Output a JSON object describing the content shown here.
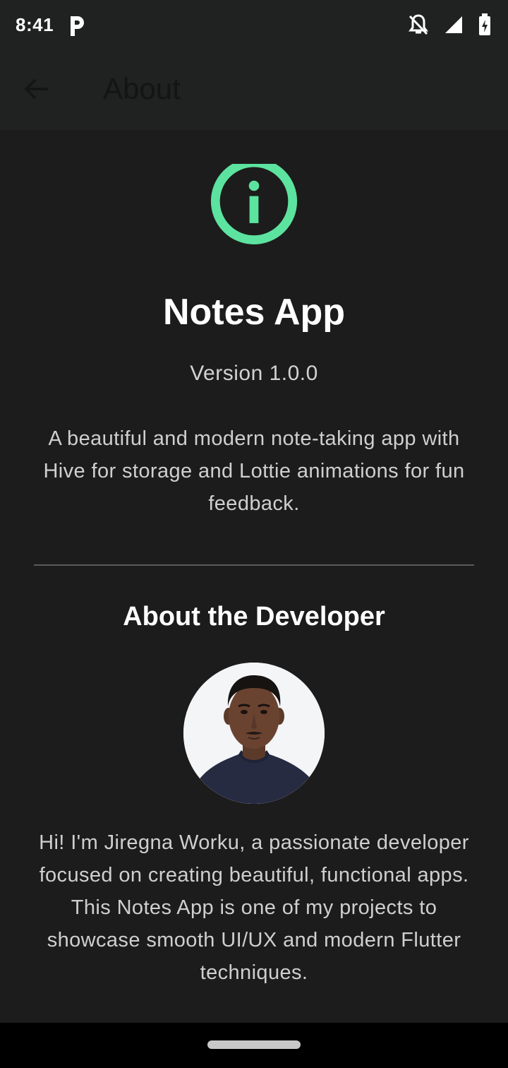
{
  "status_bar": {
    "time": "8:41",
    "icons": [
      "p-app-icon",
      "notifications-off-icon",
      "signal-icon",
      "battery-icon"
    ]
  },
  "app_bar": {
    "title": "About",
    "back_icon": "arrow-back-icon"
  },
  "about": {
    "icon": "info-icon",
    "app_name": "Notes App",
    "version": "Version 1.0.0",
    "description": "A beautiful and modern note-taking app with Hive for storage and Lottie animations for fun feedback.",
    "developer_heading": "About the Developer",
    "developer_bio": "Hi! I'm Jiregna Worku, a passionate developer focused on creating beautiful, functional apps. This Notes App is one of my projects to showcase smooth UI/UX and modern Flutter techniques."
  },
  "colors": {
    "background": "#1c1c1c",
    "app_bar": "#1f2221",
    "accent": "#5ce39f",
    "text_primary": "#ffffff",
    "text_secondary": "#cfcfcf"
  }
}
